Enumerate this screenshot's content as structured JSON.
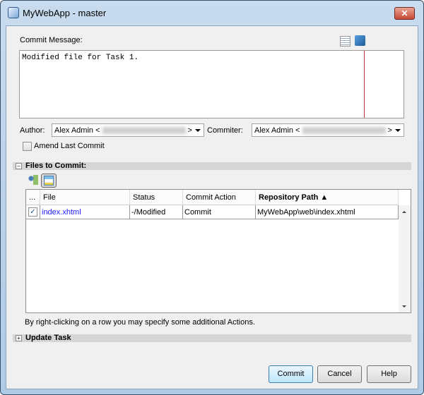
{
  "window": {
    "title": "MyWebApp - master",
    "close_label": "✕"
  },
  "commit_message": {
    "label": "Commit Message:",
    "value": "Modified file for Task 1."
  },
  "author": {
    "label": "Author:",
    "name": "Alex Admin <",
    "suffix": ">"
  },
  "committer": {
    "label": "Commiter:",
    "name": "Alex Admin <",
    "suffix": ">"
  },
  "amend": {
    "label": "Amend Last Commit",
    "checked": false
  },
  "files_section": {
    "title": "Files to Commit:",
    "toggle": "−"
  },
  "table": {
    "headers": [
      "...",
      "File",
      "Status",
      "Commit Action",
      "Repository Path ▲"
    ],
    "rows": [
      {
        "checked": true,
        "file": "index.xhtml",
        "status": "-/Modified",
        "action": "Commit",
        "path": "MyWebApp\\web\\index.xhtml"
      }
    ]
  },
  "hint": "By right-clicking on a row you may specify some additional Actions.",
  "update_task": {
    "title": "Update Task",
    "toggle": "+"
  },
  "buttons": {
    "commit": "Commit",
    "cancel": "Cancel",
    "help": "Help"
  },
  "colors": {
    "file_link": "#1a1aff",
    "section_bar": "#d6d6d6"
  }
}
